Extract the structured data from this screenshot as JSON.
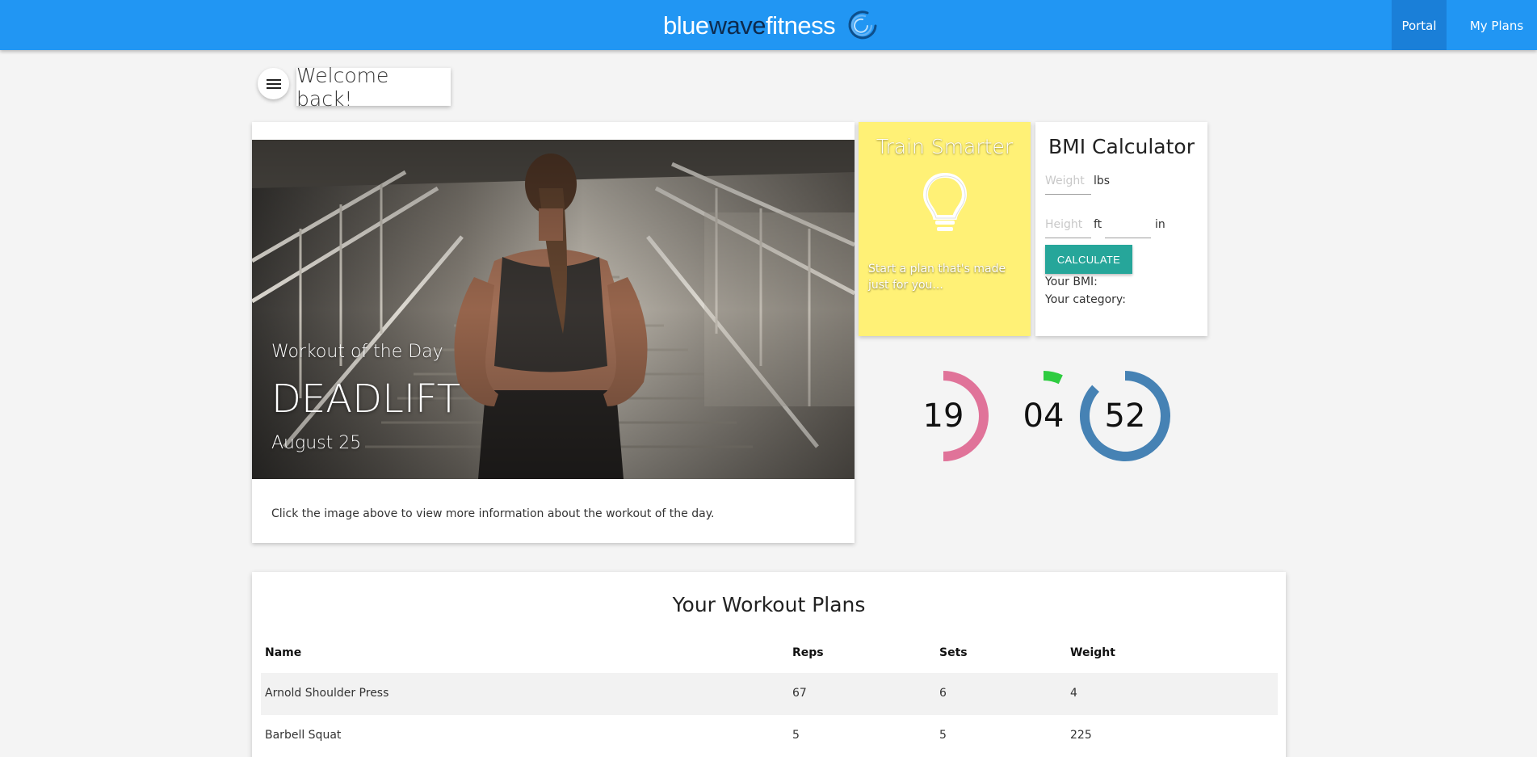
{
  "nav": {
    "brand": {
      "part1": "blue",
      "part2": "wave",
      "part3": "fitness"
    },
    "items": [
      {
        "label": "Portal"
      },
      {
        "label": "My Plans"
      }
    ],
    "accent": "#2196f3"
  },
  "header": {
    "menu_icon": "hamburger-menu-icon",
    "welcome": "Welcome back!"
  },
  "wod": {
    "subtitle": "Workout of the Day",
    "title": "DEADLIFT",
    "date": "August 25",
    "description": "Click the image above to view more information about the workout of the day."
  },
  "train": {
    "title": "Train Smarter",
    "icon": "lightbulb-icon",
    "text": "Start a plan that's made just for you...",
    "color": "#fff176"
  },
  "bmi": {
    "title": "BMI Calculator",
    "weight_placeholder": "Weight",
    "weight_unit": "lbs",
    "height_placeholder": "Height",
    "height_unit_ft": "ft",
    "height_unit_in": "in",
    "button_label": "CALCULATE",
    "result_label": "Your BMI:",
    "category_label": "Your category:",
    "button_color": "#26a69a"
  },
  "countdown": [
    {
      "value": "19",
      "fraction": 0.5,
      "color": "#e07399"
    },
    {
      "value": "04",
      "fraction": 0.07,
      "color": "#2ecc40"
    },
    {
      "value": "52",
      "fraction": 0.87,
      "color": "#4682b4"
    }
  ],
  "plans": {
    "title": "Your Workout Plans",
    "columns": [
      "Name",
      "Reps",
      "Sets",
      "Weight"
    ],
    "rows": [
      {
        "name": "Arnold Shoulder Press",
        "reps": "67",
        "sets": "6",
        "weight": "4"
      },
      {
        "name": "Barbell Squat",
        "reps": "5",
        "sets": "5",
        "weight": "225"
      }
    ]
  }
}
